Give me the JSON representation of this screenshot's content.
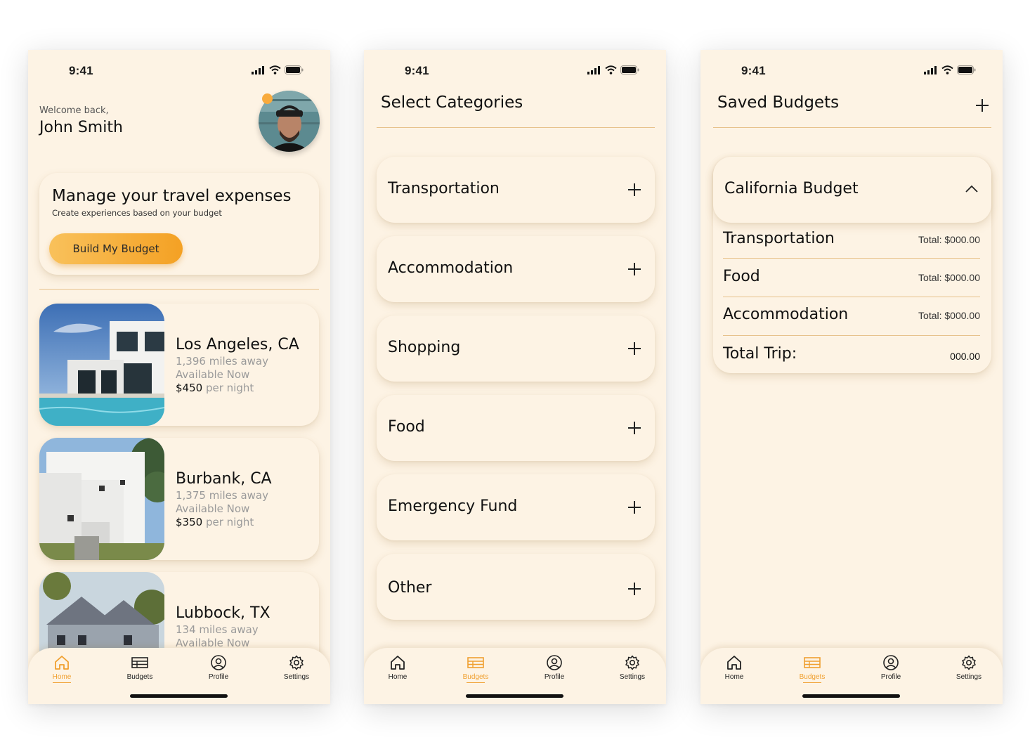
{
  "status": {
    "time": "9:41"
  },
  "home": {
    "welcome": "Welcome back,",
    "user_name": "John Smith",
    "hero": {
      "title": "Manage your travel expenses",
      "subtitle": "Create experiences based on your budget",
      "cta": "Build My Budget"
    },
    "listings": [
      {
        "city": "Los Angeles, CA",
        "distance": "1,396 miles away",
        "availability": "Available Now",
        "price": "$450",
        "per": " per night"
      },
      {
        "city": "Burbank, CA",
        "distance": "1,375 miles away",
        "availability": "Available Now",
        "price": "$350",
        "per": " per night"
      },
      {
        "city": "Lubbock, TX",
        "distance": "134 miles away",
        "availability": "Available Now"
      }
    ]
  },
  "categories": {
    "title": "Select Categories",
    "items": [
      "Transportation",
      "Accommodation",
      "Shopping",
      "Food",
      "Emergency Fund",
      "Other"
    ]
  },
  "saved": {
    "title": "Saved Budgets",
    "budget_name": "California Budget",
    "rows": [
      {
        "label": "Transportation",
        "total_label": "Total:",
        "total_value": "$000.00"
      },
      {
        "label": "Food",
        "total_label": "Total:",
        "total_value": "$000.00"
      },
      {
        "label": "Accommodation",
        "total_label": "Total:",
        "total_value": "$000.00"
      }
    ],
    "trip_label": "Total Trip:",
    "trip_value": "000.00"
  },
  "tabs": [
    "Home",
    "Budgets",
    "Profile",
    "Settings"
  ],
  "colors": {
    "background": "#fdf3e4",
    "accent": "#f4a124",
    "separator": "#e7c28b"
  },
  "icons": {
    "home": "home-icon",
    "budgets": "table-icon",
    "profile": "user-circle-icon",
    "settings": "gear-icon"
  }
}
